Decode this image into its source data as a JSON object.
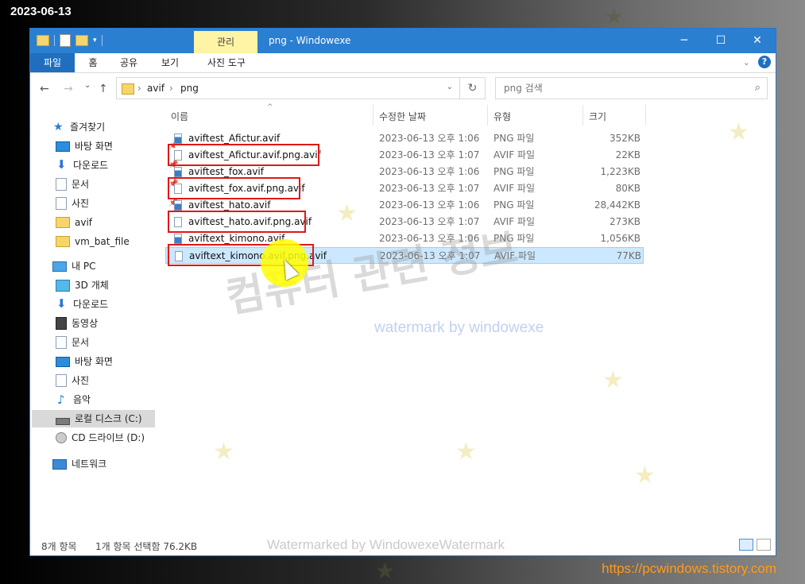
{
  "overlay": {
    "date": "2023-06-13",
    "site": "https://pcwindows.tistory.com"
  },
  "window": {
    "context_tab": "관리",
    "title": "png   - Windowexe",
    "controls": {
      "minimize": "─",
      "maximize": "☐",
      "close": "✕"
    }
  },
  "ribbon": {
    "tabs": [
      "파일",
      "홈",
      "공유",
      "보기",
      "사진 도구"
    ],
    "expand_icon": "chevron-down-icon",
    "help": "?"
  },
  "address": {
    "back": "←",
    "forward": "→",
    "recent": "⌄",
    "up": "↑",
    "crumbs": [
      "avif",
      "png"
    ],
    "separator": "›",
    "refresh": "↻",
    "search_placeholder": "png 검색"
  },
  "nav": {
    "quick_access": "즐겨찾기",
    "quick_items": [
      {
        "label": "바탕 화면",
        "icon": "desktop-icon",
        "pinned": true
      },
      {
        "label": "다운로드",
        "icon": "download-icon",
        "pinned": true
      },
      {
        "label": "문서",
        "icon": "document-icon",
        "pinned": true
      },
      {
        "label": "사진",
        "icon": "pictures-icon",
        "pinned": true
      },
      {
        "label": "avif",
        "icon": "folder-icon",
        "pinned": false
      },
      {
        "label": "vm_bat_file",
        "icon": "folder-icon",
        "pinned": false
      }
    ],
    "this_pc": "내 PC",
    "pc_items": [
      {
        "label": "3D 개체",
        "icon": "3d-objects-icon"
      },
      {
        "label": "다운로드",
        "icon": "download-icon"
      },
      {
        "label": "동영상",
        "icon": "video-icon"
      },
      {
        "label": "문서",
        "icon": "document-icon"
      },
      {
        "label": "바탕 화면",
        "icon": "desktop-icon"
      },
      {
        "label": "사진",
        "icon": "pictures-icon"
      },
      {
        "label": "음악",
        "icon": "music-icon"
      },
      {
        "label": "로컬 디스크 (C:)",
        "icon": "drive-icon",
        "selected": true
      },
      {
        "label": "CD 드라이브 (D:)",
        "icon": "cd-drive-icon"
      }
    ],
    "network": "네트워크"
  },
  "columns": {
    "name": "이름",
    "date": "수정한 날짜",
    "type": "유형",
    "size": "크기"
  },
  "files": [
    {
      "name": "aviftest_Afictur.avif",
      "date": "2023-06-13 오후 1:06",
      "type": "PNG 파일",
      "size": "352KB",
      "kind": "png",
      "highlighted": false,
      "selected": false
    },
    {
      "name": "aviftest_Afictur.avif.png.avif",
      "date": "2023-06-13 오후 1:07",
      "type": "AVIF 파일",
      "size": "22KB",
      "kind": "avif",
      "highlighted": true,
      "selected": false
    },
    {
      "name": "aviftest_fox.avif",
      "date": "2023-06-13 오후 1:06",
      "type": "PNG 파일",
      "size": "1,223KB",
      "kind": "png",
      "highlighted": false,
      "selected": false
    },
    {
      "name": "aviftest_fox.avif.png.avif",
      "date": "2023-06-13 오후 1:07",
      "type": "AVIF 파일",
      "size": "80KB",
      "kind": "avif",
      "highlighted": true,
      "selected": false
    },
    {
      "name": "aviftest_hato.avif",
      "date": "2023-06-13 오후 1:06",
      "type": "PNG 파일",
      "size": "28,442KB",
      "kind": "png",
      "highlighted": false,
      "selected": false
    },
    {
      "name": "aviftest_hato.avif.png.avif",
      "date": "2023-06-13 오후 1:07",
      "type": "AVIF 파일",
      "size": "273KB",
      "kind": "avif",
      "highlighted": true,
      "selected": false
    },
    {
      "name": "aviftext_kimono.avif",
      "date": "2023-06-13 오후 1:06",
      "type": "PNG 파일",
      "size": "1,056KB",
      "kind": "png",
      "highlighted": false,
      "selected": false
    },
    {
      "name": "aviftext_kimono.avif.png.avif",
      "date": "2023-06-13 오후 1:07",
      "type": "AVIF 파일",
      "size": "77KB",
      "kind": "avif",
      "highlighted": true,
      "selected": true
    }
  ],
  "watermarks": {
    "big": "컴퓨터 관련 정보",
    "small": "watermark by windowexe",
    "bottom": "Watermarked by WindowexeWatermark"
  },
  "status": {
    "count": "8개 항목",
    "selection": "1개 항목 선택함 76.2KB"
  }
}
